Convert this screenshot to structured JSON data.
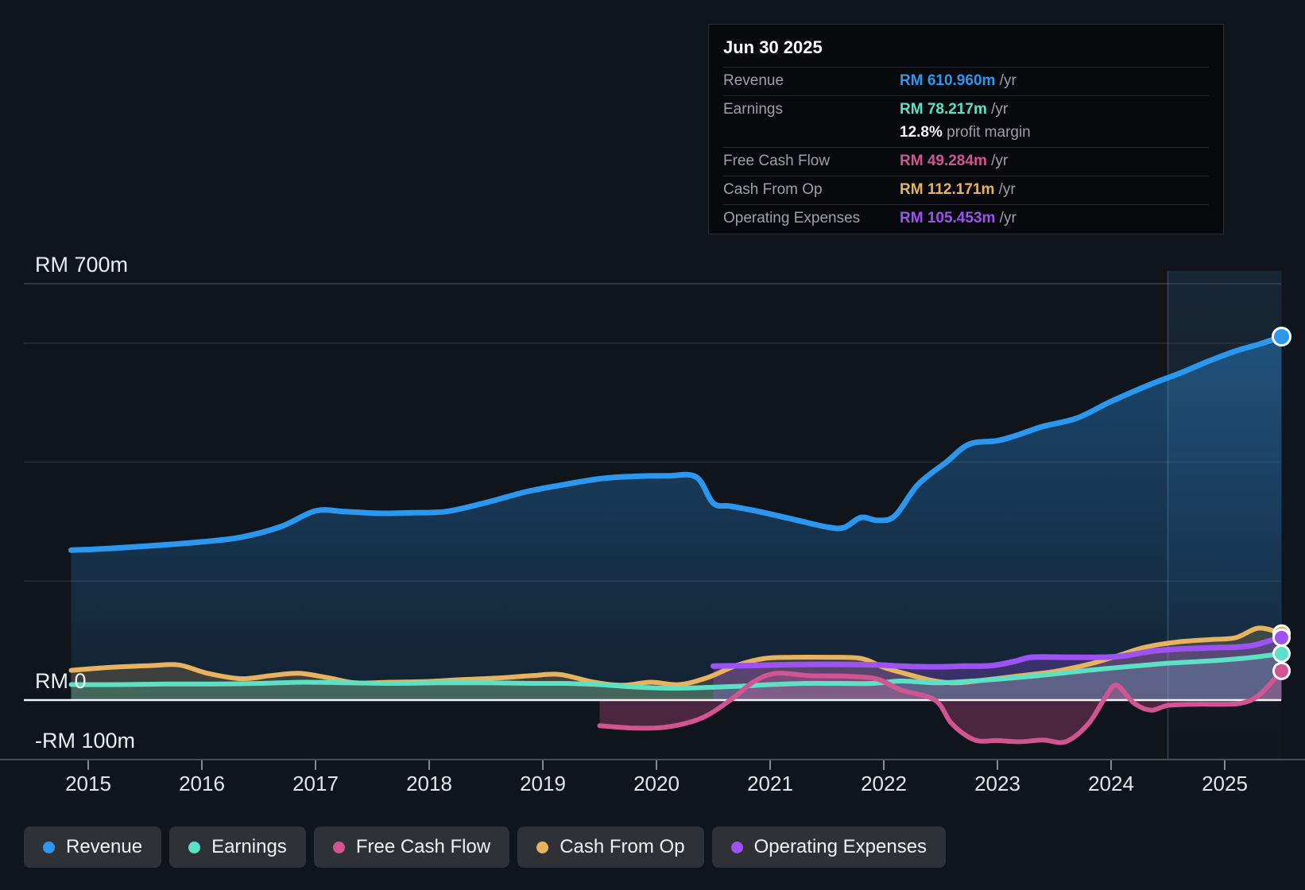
{
  "colors": {
    "revenue": "#2b97ee",
    "earnings": "#5de1c5",
    "fcf": "#d15591",
    "cashop": "#e8b35f",
    "opex": "#9d52f2",
    "grid": "#40454c",
    "zero_line": "#f1f4f6",
    "axis_line": "#4a4f56",
    "tick": "#868c94",
    "label_text": "#e9edf0",
    "muted_text": "#9aa1a9",
    "legend_bg": "#2e3237",
    "tooltip_bg": "#07090d",
    "page_bg": "#10141b"
  },
  "tooltip": {
    "title": "Jun 30 2025",
    "rows": [
      {
        "label": "Revenue",
        "value": "RM 610.960m",
        "unit": " /yr",
        "key": "revenue"
      },
      {
        "label": "Earnings",
        "value": "RM 78.217m",
        "unit": " /yr",
        "key": "earnings",
        "sub": {
          "value": "12.8%",
          "text": " profit margin"
        }
      },
      {
        "label": "Free Cash Flow",
        "value": "RM 49.284m",
        "unit": " /yr",
        "key": "fcf"
      },
      {
        "label": "Cash From Op",
        "value": "RM 112.171m",
        "unit": " /yr",
        "key": "cashop"
      },
      {
        "label": "Operating Expenses",
        "value": "RM 105.453m",
        "unit": " /yr",
        "key": "opex"
      }
    ]
  },
  "legend": [
    {
      "label": "Revenue",
      "key": "revenue"
    },
    {
      "label": "Earnings",
      "key": "earnings"
    },
    {
      "label": "Free Cash Flow",
      "key": "fcf"
    },
    {
      "label": "Cash From Op",
      "key": "cashop"
    },
    {
      "label": "Operating Expenses",
      "key": "opex"
    }
  ],
  "chart_data": {
    "type": "area",
    "x_unit": "year",
    "x_domain": [
      2014.85,
      2025.5
    ],
    "y_unit": "RM millions",
    "y_domain": [
      -100,
      700
    ],
    "x_ticks": [
      "2015",
      "2016",
      "2017",
      "2018",
      "2019",
      "2020",
      "2021",
      "2022",
      "2023",
      "2024",
      "2025"
    ],
    "y_labels": [
      {
        "text": "RM 700m",
        "m": 700
      },
      {
        "text": "RM 0",
        "m": 0
      },
      {
        "text": "-RM 100m",
        "m": -100
      }
    ],
    "gridlines_m": [
      700,
      600,
      400,
      200
    ],
    "zero_line_m": 0,
    "bottom_axis_m": -100,
    "highlight_span_years": [
      2024.5,
      2025.5
    ],
    "legend_position": "bottom",
    "series": [
      {
        "name": "Revenue",
        "key": "revenue",
        "line_width": 7,
        "fill_opacity": 0.32,
        "points": [
          [
            2014.85,
            252
          ],
          [
            2015.2,
            255
          ],
          [
            2015.6,
            260
          ],
          [
            2016,
            266
          ],
          [
            2016.35,
            274
          ],
          [
            2016.7,
            292
          ],
          [
            2017,
            318
          ],
          [
            2017.25,
            317
          ],
          [
            2017.55,
            314
          ],
          [
            2017.85,
            315
          ],
          [
            2018.15,
            317
          ],
          [
            2018.5,
            332
          ],
          [
            2018.85,
            350
          ],
          [
            2019.15,
            361
          ],
          [
            2019.5,
            372
          ],
          [
            2019.8,
            376
          ],
          [
            2020.1,
            377
          ],
          [
            2020.35,
            375
          ],
          [
            2020.5,
            331
          ],
          [
            2020.65,
            326
          ],
          [
            2020.9,
            317
          ],
          [
            2021.2,
            304
          ],
          [
            2021.5,
            291
          ],
          [
            2021.65,
            290
          ],
          [
            2021.8,
            307
          ],
          [
            2021.95,
            302
          ],
          [
            2022.1,
            310
          ],
          [
            2022.3,
            362
          ],
          [
            2022.55,
            400
          ],
          [
            2022.75,
            430
          ],
          [
            2023,
            436
          ],
          [
            2023.2,
            447
          ],
          [
            2023.4,
            460
          ],
          [
            2023.7,
            474
          ],
          [
            2024,
            502
          ],
          [
            2024.35,
            531
          ],
          [
            2024.6,
            549
          ],
          [
            2024.85,
            569
          ],
          [
            2025.1,
            587
          ],
          [
            2025.3,
            598
          ],
          [
            2025.5,
            611
          ]
        ]
      },
      {
        "name": "Cash From Op",
        "key": "cashop",
        "line_width": 6,
        "fill_opacity": 0.2,
        "points": [
          [
            2014.85,
            50
          ],
          [
            2015.2,
            55
          ],
          [
            2015.55,
            58
          ],
          [
            2015.8,
            59
          ],
          [
            2016.05,
            45
          ],
          [
            2016.35,
            36
          ],
          [
            2016.6,
            41
          ],
          [
            2016.85,
            45
          ],
          [
            2017.1,
            38
          ],
          [
            2017.35,
            29
          ],
          [
            2017.65,
            30
          ],
          [
            2017.95,
            31
          ],
          [
            2018.25,
            34
          ],
          [
            2018.6,
            37
          ],
          [
            2018.9,
            41
          ],
          [
            2019.15,
            43
          ],
          [
            2019.45,
            30
          ],
          [
            2019.7,
            25
          ],
          [
            2019.95,
            30
          ],
          [
            2020.2,
            26
          ],
          [
            2020.45,
            38
          ],
          [
            2020.7,
            58
          ],
          [
            2020.95,
            70
          ],
          [
            2021.2,
            72
          ],
          [
            2021.5,
            72
          ],
          [
            2021.8,
            70
          ],
          [
            2022,
            55
          ],
          [
            2022.2,
            44
          ],
          [
            2022.45,
            32
          ],
          [
            2022.65,
            29
          ],
          [
            2022.9,
            34
          ],
          [
            2023.2,
            41
          ],
          [
            2023.5,
            48
          ],
          [
            2023.8,
            60
          ],
          [
            2024.05,
            74
          ],
          [
            2024.3,
            89
          ],
          [
            2024.6,
            98
          ],
          [
            2024.9,
            102
          ],
          [
            2025.1,
            105
          ],
          [
            2025.3,
            121
          ],
          [
            2025.5,
            112
          ]
        ]
      },
      {
        "name": "Earnings",
        "key": "earnings",
        "line_width": 6,
        "fill_opacity": 0.25,
        "points": [
          [
            2014.85,
            26
          ],
          [
            2015.3,
            26
          ],
          [
            2015.7,
            27
          ],
          [
            2016.1,
            27
          ],
          [
            2016.5,
            28
          ],
          [
            2016.9,
            30
          ],
          [
            2017.3,
            29
          ],
          [
            2017.7,
            28
          ],
          [
            2018.1,
            29
          ],
          [
            2018.5,
            29
          ],
          [
            2018.9,
            28
          ],
          [
            2019.2,
            28
          ],
          [
            2019.5,
            26
          ],
          [
            2019.8,
            22
          ],
          [
            2020.1,
            20
          ],
          [
            2020.4,
            21
          ],
          [
            2020.7,
            23
          ],
          [
            2021,
            26
          ],
          [
            2021.3,
            28
          ],
          [
            2021.6,
            28
          ],
          [
            2021.9,
            28
          ],
          [
            2022.15,
            32
          ],
          [
            2022.45,
            29
          ],
          [
            2022.7,
            31
          ],
          [
            2023,
            35
          ],
          [
            2023.3,
            40
          ],
          [
            2023.6,
            46
          ],
          [
            2023.9,
            52
          ],
          [
            2024.2,
            57
          ],
          [
            2024.5,
            62
          ],
          [
            2024.8,
            65
          ],
          [
            2025.1,
            69
          ],
          [
            2025.3,
            73
          ],
          [
            2025.5,
            78
          ]
        ]
      },
      {
        "name": "Operating Expenses",
        "key": "opex",
        "line_width": 7,
        "fill_opacity": 0.28,
        "points": [
          [
            2020.5,
            57
          ],
          [
            2020.8,
            58
          ],
          [
            2021.05,
            59
          ],
          [
            2021.35,
            60
          ],
          [
            2021.65,
            60
          ],
          [
            2021.95,
            59
          ],
          [
            2022.15,
            57
          ],
          [
            2022.45,
            56
          ],
          [
            2022.7,
            57
          ],
          [
            2022.95,
            58
          ],
          [
            2023.15,
            65
          ],
          [
            2023.3,
            72
          ],
          [
            2023.6,
            72
          ],
          [
            2023.9,
            72
          ],
          [
            2024.1,
            74
          ],
          [
            2024.35,
            82
          ],
          [
            2024.6,
            86
          ],
          [
            2024.9,
            88
          ],
          [
            2025.1,
            89
          ],
          [
            2025.25,
            92
          ],
          [
            2025.4,
            100
          ],
          [
            2025.5,
            105
          ]
        ]
      },
      {
        "name": "Free Cash Flow",
        "key": "fcf",
        "line_width": 6,
        "fill_opacity": 0.3,
        "points": [
          [
            2019.5,
            -43
          ],
          [
            2019.8,
            -47
          ],
          [
            2020.1,
            -45
          ],
          [
            2020.4,
            -30
          ],
          [
            2020.65,
            0
          ],
          [
            2020.85,
            30
          ],
          [
            2021.05,
            45
          ],
          [
            2021.35,
            41
          ],
          [
            2021.7,
            40
          ],
          [
            2021.95,
            35
          ],
          [
            2022.15,
            17
          ],
          [
            2022.45,
            0
          ],
          [
            2022.6,
            -40
          ],
          [
            2022.8,
            -67
          ],
          [
            2023,
            -68
          ],
          [
            2023.2,
            -70
          ],
          [
            2023.4,
            -67
          ],
          [
            2023.6,
            -70
          ],
          [
            2023.8,
            -40
          ],
          [
            2023.95,
            5
          ],
          [
            2024.05,
            25
          ],
          [
            2024.2,
            -5
          ],
          [
            2024.35,
            -17
          ],
          [
            2024.5,
            -9
          ],
          [
            2024.75,
            -7
          ],
          [
            2025,
            -7
          ],
          [
            2025.15,
            -5
          ],
          [
            2025.3,
            8
          ],
          [
            2025.5,
            49
          ]
        ]
      }
    ]
  }
}
